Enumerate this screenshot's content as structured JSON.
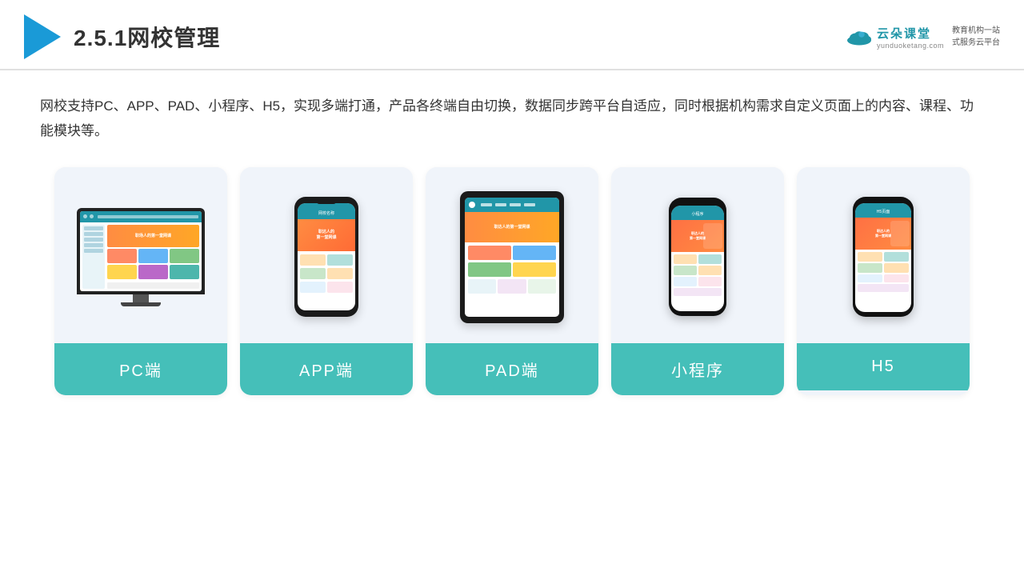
{
  "header": {
    "title": "2.5.1网校管理",
    "brand_name": "云朵课堂",
    "brand_url": "yunduoketang.com",
    "brand_tagline_1": "教育机构一站",
    "brand_tagline_2": "式服务云平台"
  },
  "description": {
    "text": "网校支持PC、APP、PAD、小程序、H5，实现多端打通，产品各终端自由切换，数据同步跨平台自适应，同时根据机构需求自定义页面上的内容、课程、功能模块等。"
  },
  "cards": [
    {
      "id": "pc",
      "label": "PC端",
      "type": "pc"
    },
    {
      "id": "app",
      "label": "APP端",
      "type": "phone"
    },
    {
      "id": "pad",
      "label": "PAD端",
      "type": "tablet"
    },
    {
      "id": "miniprogram",
      "label": "小程序",
      "type": "miniphone"
    },
    {
      "id": "h5",
      "label": "H5",
      "type": "h5phone"
    }
  ]
}
